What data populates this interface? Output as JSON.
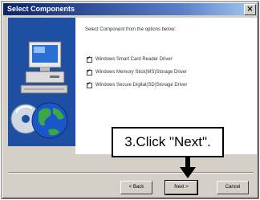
{
  "window": {
    "title": "Select Components",
    "close_glyph": "×"
  },
  "content": {
    "instruction": "Select Component from the options below:",
    "options": [
      {
        "label": "Windows Smart Card Reader Driver",
        "checked": true
      },
      {
        "label": "Windows Memory Stick(MS)Storage Driver",
        "checked": true
      },
      {
        "label": "Windows Secure Digital(SD)Storage Driver",
        "checked": true
      }
    ],
    "checkmark": "✓"
  },
  "buttons": {
    "back": "< Back",
    "next": "Next >",
    "cancel": "Cancel"
  },
  "annotation": {
    "text": "3.Click \"Next\".",
    "arrow_icon": "arrow-down-icon"
  },
  "art": {
    "icons": [
      "computer-icon",
      "globe-icon",
      "cd-icon"
    ]
  },
  "colors": {
    "title_bar": "#0a246a",
    "art_panel": "#1f4fa3",
    "window_face": "#d4d0c8"
  }
}
